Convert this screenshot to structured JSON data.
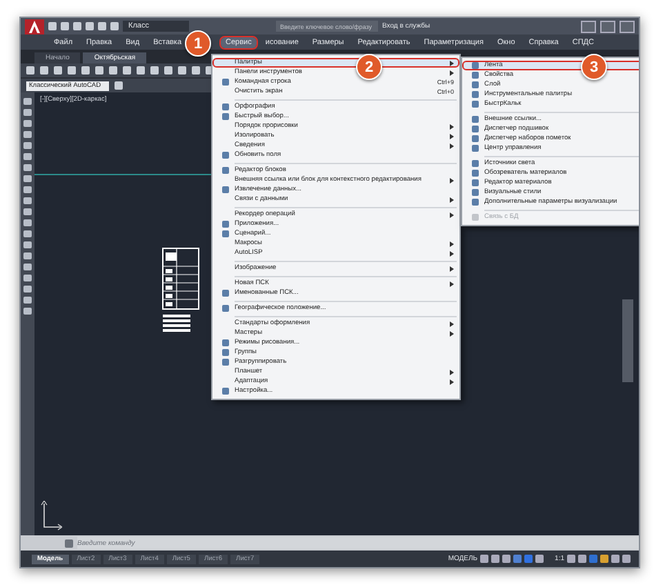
{
  "title_bar": {
    "workspace": "Класс",
    "search_placeholder": "Введите ключевое слово/фразу",
    "signin": "Вход в службы"
  },
  "menu_bar": [
    {
      "label": "Файл",
      "selected": false
    },
    {
      "label": "Правка",
      "selected": false
    },
    {
      "label": "Вид",
      "selected": false
    },
    {
      "label": "Вставка",
      "selected": false
    },
    {
      "label": "Сервис",
      "selected": true
    },
    {
      "label": "исование",
      "selected": false
    },
    {
      "label": "Размеры",
      "selected": false
    },
    {
      "label": "Редактировать",
      "selected": false
    },
    {
      "label": "Параметризация",
      "selected": false
    },
    {
      "label": "Окно",
      "selected": false
    },
    {
      "label": "Справка",
      "selected": false
    },
    {
      "label": "СПДС",
      "selected": false
    }
  ],
  "doc_tabs": [
    {
      "label": "Начало",
      "selected": false
    },
    {
      "label": "Октябрьская",
      "selected": true
    }
  ],
  "workspace_combo": "Классический AutoCAD",
  "viewport_label": "[-][Сверху][2D-каркас]",
  "menu": {
    "items": [
      {
        "kind": "item",
        "label": "Палитры",
        "submenu": true,
        "selected": true,
        "icon": false
      },
      {
        "kind": "item",
        "label": "Панели инструментов",
        "submenu": true,
        "selected": false,
        "icon": false
      },
      {
        "kind": "item",
        "label": "Командная строка",
        "shortcut": "Ctrl+9",
        "submenu": false,
        "selected": false,
        "icon": true
      },
      {
        "kind": "item",
        "label": "Очистить экран",
        "shortcut": "Ctrl+0",
        "submenu": false,
        "selected": false,
        "icon": false
      },
      {
        "kind": "separator"
      },
      {
        "kind": "item",
        "label": "Орфография",
        "submenu": false,
        "selected": false,
        "icon": true
      },
      {
        "kind": "item",
        "label": "Быстрый выбор...",
        "submenu": false,
        "selected": false,
        "icon": true
      },
      {
        "kind": "item",
        "label": "Порядок прорисовки",
        "submenu": true,
        "selected": false,
        "icon": false
      },
      {
        "kind": "item",
        "label": "Изолировать",
        "submenu": true,
        "selected": false,
        "icon": false
      },
      {
        "kind": "item",
        "label": "Сведения",
        "submenu": true,
        "selected": false,
        "icon": false
      },
      {
        "kind": "item",
        "label": "Обновить поля",
        "submenu": false,
        "selected": false,
        "icon": true
      },
      {
        "kind": "separator"
      },
      {
        "kind": "item",
        "label": "Редактор блоков",
        "submenu": false,
        "selected": false,
        "icon": true
      },
      {
        "kind": "item",
        "label": "Внешняя ссылка или блок для контекстного редактирования",
        "submenu": true,
        "selected": false,
        "icon": false
      },
      {
        "kind": "item",
        "label": "Извлечение данных...",
        "submenu": false,
        "selected": false,
        "icon": true
      },
      {
        "kind": "item",
        "label": "Связи с данными",
        "submenu": true,
        "selected": false,
        "icon": false
      },
      {
        "kind": "separator"
      },
      {
        "kind": "item",
        "label": "Рекордер операций",
        "submenu": true,
        "selected": false,
        "icon": false
      },
      {
        "kind": "item",
        "label": "Приложения...",
        "submenu": false,
        "selected": false,
        "icon": true
      },
      {
        "kind": "item",
        "label": "Сценарий...",
        "submenu": false,
        "selected": false,
        "icon": true
      },
      {
        "kind": "item",
        "label": "Макросы",
        "submenu": true,
        "selected": false,
        "icon": false
      },
      {
        "kind": "item",
        "label": "AutoLISP",
        "submenu": true,
        "selected": false,
        "icon": false
      },
      {
        "kind": "separator"
      },
      {
        "kind": "item",
        "label": "Изображение",
        "submenu": true,
        "selected": false,
        "icon": false
      },
      {
        "kind": "separator"
      },
      {
        "kind": "item",
        "label": "Новая ПСК",
        "submenu": true,
        "selected": false,
        "icon": false
      },
      {
        "kind": "item",
        "label": "Именованные ПСК...",
        "submenu": false,
        "selected": false,
        "icon": true
      },
      {
        "kind": "separator"
      },
      {
        "kind": "item",
        "label": "Географическое положение...",
        "submenu": false,
        "selected": false,
        "icon": true
      },
      {
        "kind": "separator"
      },
      {
        "kind": "item",
        "label": "Стандарты оформления",
        "submenu": true,
        "selected": false,
        "icon": false
      },
      {
        "kind": "item",
        "label": "Мастеры",
        "submenu": true,
        "selected": false,
        "icon": false
      },
      {
        "kind": "item",
        "label": "Режимы рисования...",
        "submenu": false,
        "selected": false,
        "icon": true
      },
      {
        "kind": "item",
        "label": "Группы",
        "submenu": false,
        "selected": false,
        "icon": true
      },
      {
        "kind": "item",
        "label": "Разгруппировать",
        "submenu": false,
        "selected": false,
        "icon": true
      },
      {
        "kind": "item",
        "label": "Планшет",
        "submenu": true,
        "selected": false,
        "icon": false
      },
      {
        "kind": "item",
        "label": "Адаптация",
        "submenu": true,
        "selected": false,
        "icon": false
      },
      {
        "kind": "item",
        "label": "Настройка...",
        "submenu": false,
        "selected": false,
        "icon": true
      }
    ]
  },
  "submenu": {
    "items": [
      {
        "kind": "item",
        "label": "Лента",
        "selected": true,
        "disabled": false
      },
      {
        "kind": "item",
        "label": "Свойства",
        "selected": false,
        "disabled": false
      },
      {
        "kind": "item",
        "label": "Слой",
        "selected": false,
        "disabled": false
      },
      {
        "kind": "item",
        "label": "Инструментальные палитры",
        "selected": false,
        "disabled": false
      },
      {
        "kind": "item",
        "label": "БыстрКальк",
        "selected": false,
        "disabled": false
      },
      {
        "kind": "separator"
      },
      {
        "kind": "item",
        "label": "Внешние ссылки...",
        "selected": false,
        "disabled": false
      },
      {
        "kind": "item",
        "label": "Диспетчер подшивок",
        "selected": false,
        "disabled": false
      },
      {
        "kind": "item",
        "label": "Диспетчер наборов пометок",
        "selected": false,
        "disabled": false
      },
      {
        "kind": "item",
        "label": "Центр управления",
        "selected": false,
        "disabled": false
      },
      {
        "kind": "separator"
      },
      {
        "kind": "item",
        "label": "Источники света",
        "selected": false,
        "disabled": false
      },
      {
        "kind": "item",
        "label": "Обозреватель материалов",
        "selected": false,
        "disabled": false
      },
      {
        "kind": "item",
        "label": "Редактор материалов",
        "selected": false,
        "disabled": false
      },
      {
        "kind": "item",
        "label": "Визуальные стили",
        "selected": false,
        "disabled": false
      },
      {
        "kind": "item",
        "label": "Дополнительные параметры визуализации",
        "selected": false,
        "disabled": false
      },
      {
        "kind": "separator"
      },
      {
        "kind": "item",
        "label": "Связь с БД",
        "selected": false,
        "disabled": true
      }
    ]
  },
  "callouts": [
    "1",
    "2",
    "3"
  ],
  "command_placeholder": "Введите команду",
  "layout_tabs": [
    {
      "label": "Модель",
      "selected": true
    },
    {
      "label": "Лист2",
      "selected": false
    },
    {
      "label": "Лист3",
      "selected": false
    },
    {
      "label": "Лист4",
      "selected": false
    },
    {
      "label": "Лист5",
      "selected": false
    },
    {
      "label": "Лист6",
      "selected": false
    },
    {
      "label": "Лист7",
      "selected": false
    }
  ],
  "status_bar": {
    "model": "МОДЕЛЬ",
    "scale": "1:1"
  }
}
